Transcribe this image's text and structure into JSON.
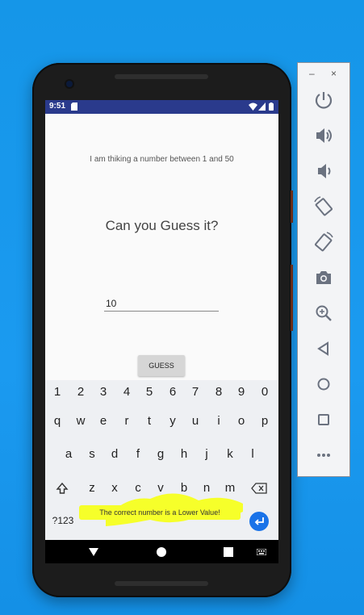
{
  "status_bar": {
    "time": "9:51"
  },
  "app": {
    "prompt_text": "I am thiking a number between 1 and 50",
    "question_text": "Can you Guess it?",
    "guess_value": "10",
    "guess_button_label": "GUESS"
  },
  "keyboard": {
    "number_row": [
      "1",
      "2",
      "3",
      "4",
      "5",
      "6",
      "7",
      "8",
      "9",
      "0"
    ],
    "row1": [
      "q",
      "w",
      "e",
      "r",
      "t",
      "y",
      "u",
      "i",
      "o",
      "p"
    ],
    "row2": [
      "a",
      "s",
      "d",
      "f",
      "g",
      "h",
      "j",
      "k",
      "l"
    ],
    "row3": [
      "z",
      "x",
      "c",
      "v",
      "b",
      "n",
      "m"
    ],
    "symbols_key": "?123"
  },
  "toast": {
    "text": "The correct number is a Lower Value!"
  },
  "toolbar": {
    "minimize": "–",
    "close": "×",
    "buttons": [
      "power-icon",
      "volume-up-icon",
      "volume-down-icon",
      "rotate-left-icon",
      "rotate-right-icon",
      "camera-icon",
      "zoom-icon",
      "back-icon",
      "home-icon",
      "overview-icon",
      "more-icon"
    ]
  },
  "colors": {
    "desktop_bg": "#1596e8",
    "status_bar": "#2a3a8c",
    "toast_highlight": "#f6ff2a",
    "enter_key": "#1a73e8"
  }
}
